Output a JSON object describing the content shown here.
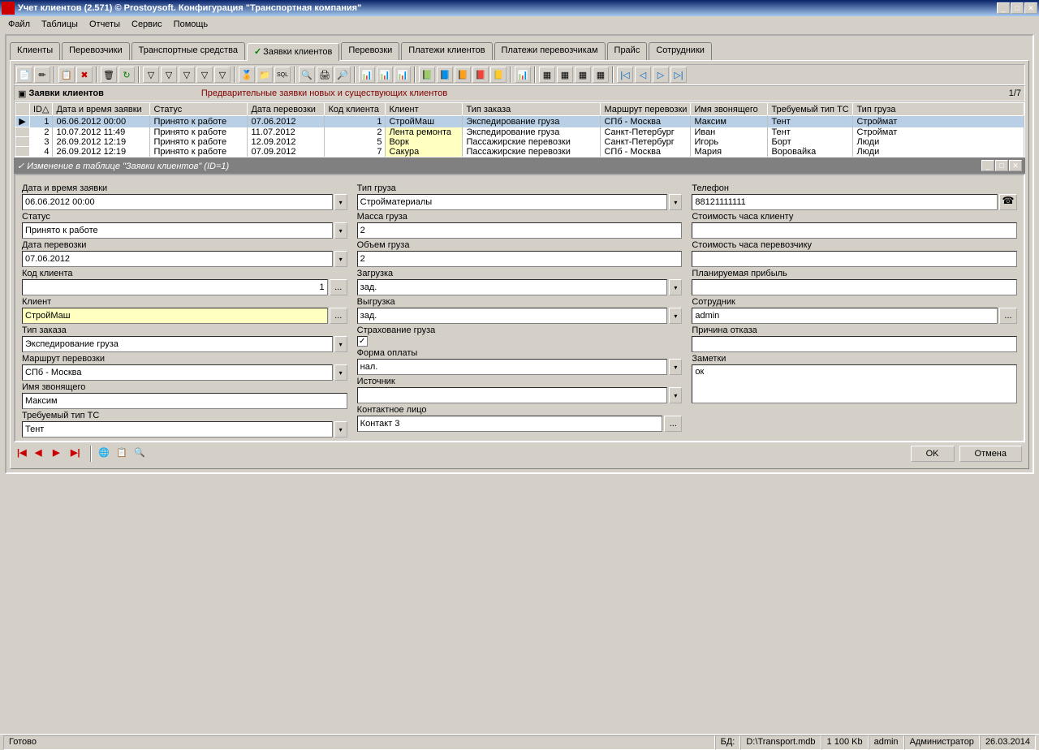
{
  "window": {
    "title": "Учет клиентов (2.571) © Prostoysoft. Конфигурация \"Транспортная компания\"",
    "min": "_",
    "max": "□",
    "close": "✕"
  },
  "menu": [
    "Файл",
    "Таблицы",
    "Отчеты",
    "Сервис",
    "Помощь"
  ],
  "tabs": [
    "Клиенты",
    "Перевозчики",
    "Транспортные средства",
    "Заявки клиентов",
    "Перевозки",
    "Платежи клиентов",
    "Платежи перевозчикам",
    "Прайс",
    "Сотрудники"
  ],
  "active_tab": 3,
  "section": {
    "title": "Заявки клиентов",
    "desc": "Предварительные заявки новых и существующих клиентов",
    "count": "1/7"
  },
  "grid": {
    "headers": [
      "ID",
      "Дата и время заявки",
      "Статус",
      "Дата перевозки",
      "Код клиента",
      "Клиент",
      "Тип заказа",
      "Маршрут перевозки",
      "Имя звонящего",
      "Требуемый тип ТС",
      "Тип груза"
    ],
    "rows": [
      [
        "1",
        "06.06.2012 00:00",
        "Принято к работе",
        "07.06.2012",
        "1",
        "СтройМаш",
        "Экспедирование груза",
        "СПб - Москва",
        "Максим",
        "Тент",
        "Строймат"
      ],
      [
        "2",
        "10.07.2012 11:49",
        "Принято к работе",
        "11.07.2012",
        "2",
        "Лента ремонта",
        "Экспедирование груза",
        "Санкт-Петербург",
        "Иван",
        "Тент",
        "Строймат"
      ],
      [
        "3",
        "26.09.2012 12:19",
        "Принято к работе",
        "12.09.2012",
        "5",
        "Ворк",
        "Пассажирские перевозки",
        "Санкт-Петербург",
        "Игорь",
        "Борт",
        "Люди"
      ],
      [
        "4",
        "26.09.2012 12:19",
        "Принято к работе",
        "07.09.2012",
        "7",
        "Сакура",
        "Пассажирские перевозки",
        "СПб - Москва",
        "Мария",
        "Воровайка",
        "Люди"
      ]
    ]
  },
  "editor": {
    "title": "✓ Изменение в таблице \"Заявки клиентов\" (ID=1)",
    "col1": {
      "f1": {
        "label": "Дата и время заявки",
        "value": "06.06.2012 00:00"
      },
      "f2": {
        "label": "Статус",
        "value": "Принято к работе"
      },
      "f3": {
        "label": "Дата перевозки",
        "value": "07.06.2012"
      },
      "f4": {
        "label": "Код клиента",
        "value": "1"
      },
      "f5": {
        "label": "Клиент",
        "value": "СтройМаш"
      },
      "f6": {
        "label": "Тип заказа",
        "value": "Экспедирование груза"
      },
      "f7": {
        "label": "Маршрут перевозки",
        "value": "СПб - Москва"
      },
      "f8": {
        "label": "Имя звонящего",
        "value": "Максим"
      },
      "f9": {
        "label": "Требуемый тип ТС",
        "value": "Тент"
      }
    },
    "col2": {
      "f1": {
        "label": "Тип груза",
        "value": "Стройматериалы"
      },
      "f2": {
        "label": "Масса груза",
        "value": "2"
      },
      "f3": {
        "label": "Объем груза",
        "value": "2"
      },
      "f4": {
        "label": "Загрузка",
        "value": "зад."
      },
      "f5": {
        "label": "Выгрузка",
        "value": "зад."
      },
      "f6": {
        "label": "Страхование груза",
        "checked": true
      },
      "f7": {
        "label": "Форма оплаты",
        "value": "нал."
      },
      "f8": {
        "label": "Источник",
        "value": ""
      },
      "f9": {
        "label": "Контактное лицо",
        "value": "Контакт 3"
      }
    },
    "col3": {
      "f1": {
        "label": "Телефон",
        "value": "88121111111"
      },
      "f2": {
        "label": "Стоимость часа клиенту",
        "value": ""
      },
      "f3": {
        "label": "Стоимость часа перевозчику",
        "value": ""
      },
      "f4": {
        "label": "Планируемая прибыль",
        "value": ""
      },
      "f5": {
        "label": "Сотрудник",
        "value": "admin"
      },
      "f6": {
        "label": "Причина отказа",
        "value": ""
      },
      "f7": {
        "label": "Заметки",
        "value": "ок"
      }
    },
    "ok": "OK",
    "cancel": "Отмена"
  },
  "status": {
    "ready": "Готово",
    "db": "БД:",
    "dbpath": "D:\\Transport.mdb",
    "size": "1 100 Kb",
    "user": "admin",
    "role": "Администратор",
    "date": "26.03.2014"
  },
  "dots": "..."
}
